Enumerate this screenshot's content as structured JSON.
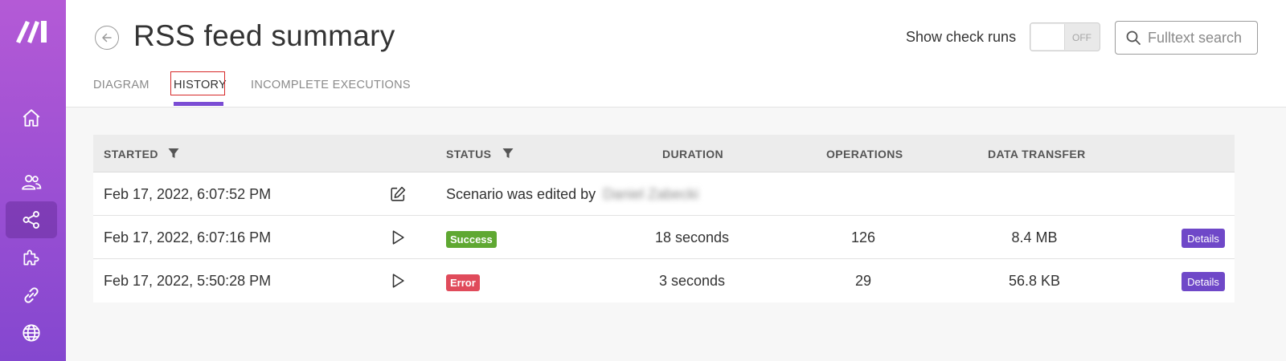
{
  "header": {
    "title": "RSS feed summary",
    "show_check_runs_label": "Show check runs",
    "toggle_state": "OFF",
    "search_placeholder": "Fulltext search"
  },
  "tabs": [
    {
      "label": "DIAGRAM",
      "active": false
    },
    {
      "label": "HISTORY",
      "active": true
    },
    {
      "label": "INCOMPLETE EXECUTIONS",
      "active": false
    }
  ],
  "sidebar": {
    "icons": [
      "make-logo",
      "home-icon",
      "team-icon",
      "scenarios-icon",
      "apps-icon",
      "connections-icon",
      "webhooks-icon"
    ],
    "active": "scenarios-icon"
  },
  "table": {
    "columns": [
      "STARTED",
      "STATUS",
      "DURATION",
      "OPERATIONS",
      "DATA TRANSFER"
    ],
    "rows": [
      {
        "started": "Feb 17, 2022, 6:07:52 PM",
        "icon": "edit-icon",
        "status_text": "Scenario was edited by",
        "editor": "Daniel Zabecki",
        "duration": "",
        "operations": "",
        "data_transfer": "",
        "action": ""
      },
      {
        "started": "Feb 17, 2022, 6:07:16 PM",
        "icon": "play-icon",
        "status": "Success",
        "duration": "18 seconds",
        "operations": "126",
        "data_transfer": "8.4 MB",
        "action": "Details"
      },
      {
        "started": "Feb 17, 2022, 5:50:28 PM",
        "icon": "play-icon",
        "status": "Error",
        "duration": "3 seconds",
        "operations": "29",
        "data_transfer": "56.8 KB",
        "action": "Details"
      }
    ]
  },
  "colors": {
    "sidebar_top": "#b45ad6",
    "sidebar_bottom": "#8447cf",
    "accent": "#7b4dd4",
    "success": "#5fa832",
    "error": "#e04b5b",
    "details_button": "#6f48c8"
  }
}
